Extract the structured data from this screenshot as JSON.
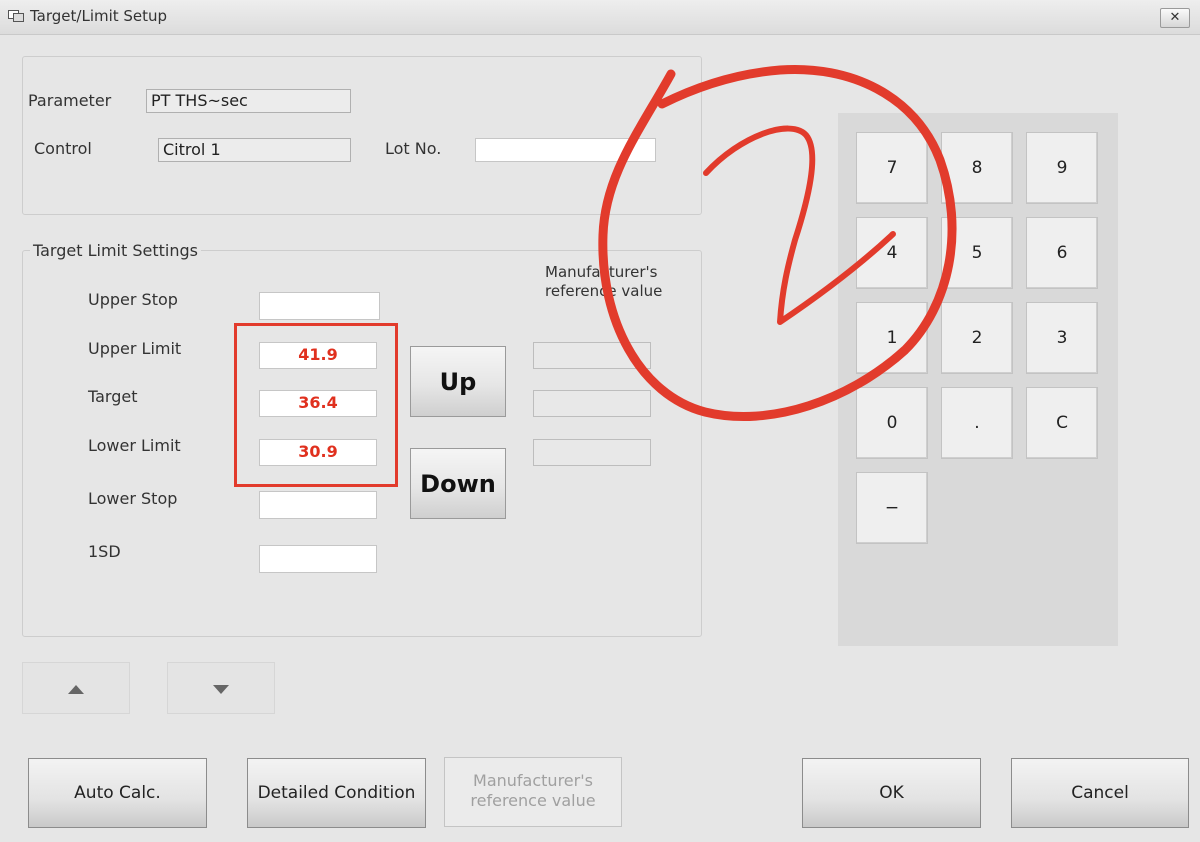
{
  "window": {
    "title": "Target/Limit Setup",
    "close_label": "✕"
  },
  "parameter_group": {
    "parameter_label": "Parameter",
    "parameter_value": "PT THS~sec",
    "control_label": "Control",
    "control_value": "Citrol 1",
    "lot_label": "Lot No.",
    "lot_value": ""
  },
  "target_group": {
    "title": "Target Limit Settings",
    "manufacturer_header": "Manufacturer's\nreference value",
    "rows": [
      {
        "label": "Upper Stop",
        "value": ""
      },
      {
        "label": "Upper Limit",
        "value": "41.9"
      },
      {
        "label": "Target",
        "value": "36.4"
      },
      {
        "label": "Lower Limit",
        "value": "30.9"
      },
      {
        "label": "Lower Stop",
        "value": ""
      },
      {
        "label": "1SD",
        "value": ""
      }
    ],
    "up_label": "Up",
    "down_label": "Down"
  },
  "keypad": {
    "keys": [
      "7",
      "8",
      "9",
      "4",
      "5",
      "6",
      "1",
      "2",
      "3",
      "0",
      ".",
      "C",
      "−"
    ]
  },
  "scroll": {
    "up_icon": "triangle-up-icon",
    "down_icon": "triangle-down-icon"
  },
  "buttons": {
    "auto_calc": "Auto Calc.",
    "detailed_condition": "Detailed Condition",
    "manufacturer_ref": "Manufacturer's\nreference value",
    "ok": "OK",
    "cancel": "Cancel"
  },
  "colors": {
    "value_red": "#e0301e",
    "annotation_red": "#e23b2c"
  }
}
